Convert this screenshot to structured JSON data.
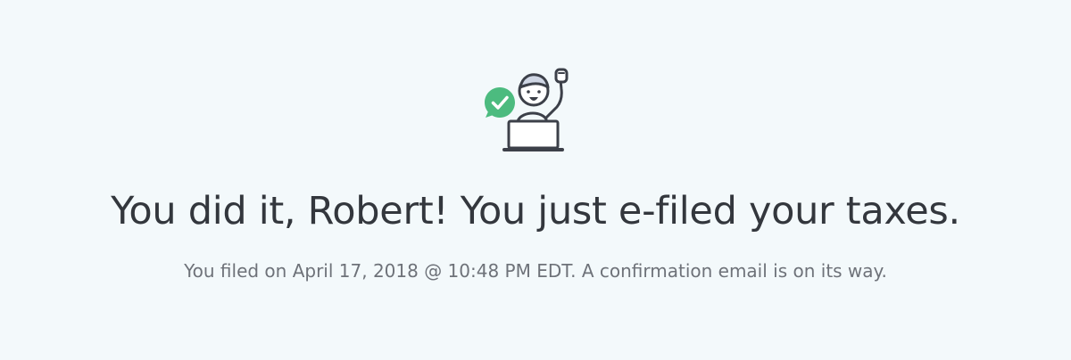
{
  "confirmation": {
    "illustration_icon": "celebrating-person-laptop-icon",
    "check_badge_icon": "check-circle-icon",
    "headline": "You did it, Robert! You just e-filed your taxes.",
    "subline": "You filed on April 17, 2018 @ 10:48 PM EDT. A confirmation email is on its way."
  },
  "colors": {
    "background": "#f3f9fb",
    "success_green": "#4cbb7f",
    "headline_text": "#33373d",
    "subline_text": "#6e7279",
    "icon_stroke": "#3c4049"
  }
}
